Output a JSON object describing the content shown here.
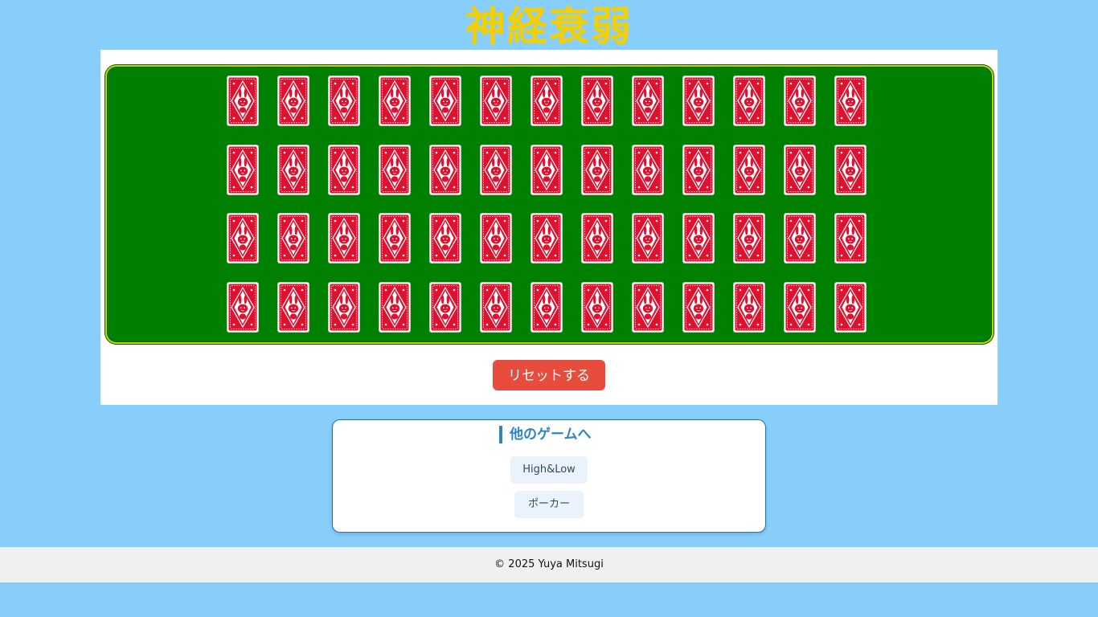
{
  "page": {
    "title": "神経衰弱"
  },
  "board": {
    "rows": 4,
    "columns": 13,
    "card_state": "face-down",
    "card_back_icon": "rabbit-card-back-icon",
    "table_color": "#008000",
    "card_back_color": "#e0102f"
  },
  "controls": {
    "reset_label": "リセットする",
    "reset_color": "#e74c3c"
  },
  "other_games": {
    "heading": "他のゲームへ",
    "links": [
      {
        "label": "High&Low"
      },
      {
        "label": "ポーカー"
      }
    ]
  },
  "footer": {
    "copyright": "© 2025 Yuya Mitsugi"
  }
}
